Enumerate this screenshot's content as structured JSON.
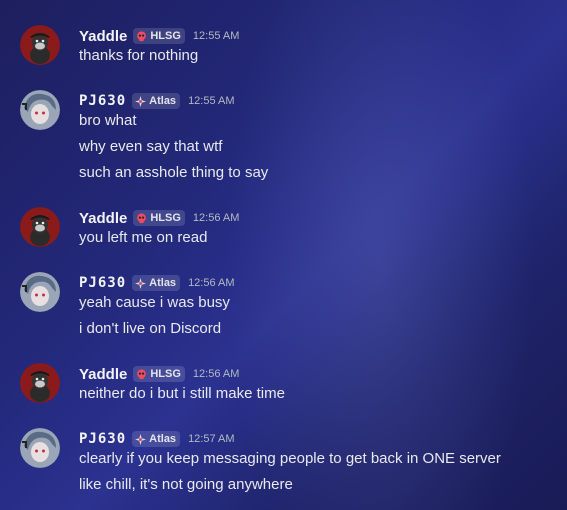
{
  "colors": {
    "background": "#23287a",
    "yaddle_avatar": "#8b1a1a",
    "pj_avatar": "#9aa6b8"
  },
  "groups": [
    {
      "author": "Yaddle",
      "tag": "HLSG",
      "tag_icon": "skull-icon",
      "time": "12:55 AM",
      "lines": [
        "thanks for nothing"
      ]
    },
    {
      "author": "PJ630",
      "tag": "Atlas",
      "tag_icon": "compass-icon",
      "time": "12:55 AM",
      "lines": [
        "bro what",
        "why even say that wtf",
        "such an asshole thing to say"
      ]
    },
    {
      "author": "Yaddle",
      "tag": "HLSG",
      "tag_icon": "skull-icon",
      "time": "12:56 AM",
      "lines": [
        "you left me on read"
      ]
    },
    {
      "author": "PJ630",
      "tag": "Atlas",
      "tag_icon": "compass-icon",
      "time": "12:56 AM",
      "lines": [
        "yeah cause i was busy",
        "i don't live on Discord"
      ]
    },
    {
      "author": "Yaddle",
      "tag": "HLSG",
      "tag_icon": "skull-icon",
      "time": "12:56 AM",
      "lines": [
        "neither do i but i still make time"
      ]
    },
    {
      "author": "PJ630",
      "tag": "Atlas",
      "tag_icon": "compass-icon",
      "time": "12:57 AM",
      "lines": [
        "clearly if you keep messaging people to get back in ONE server",
        "like chill, it's not going anywhere"
      ]
    }
  ]
}
